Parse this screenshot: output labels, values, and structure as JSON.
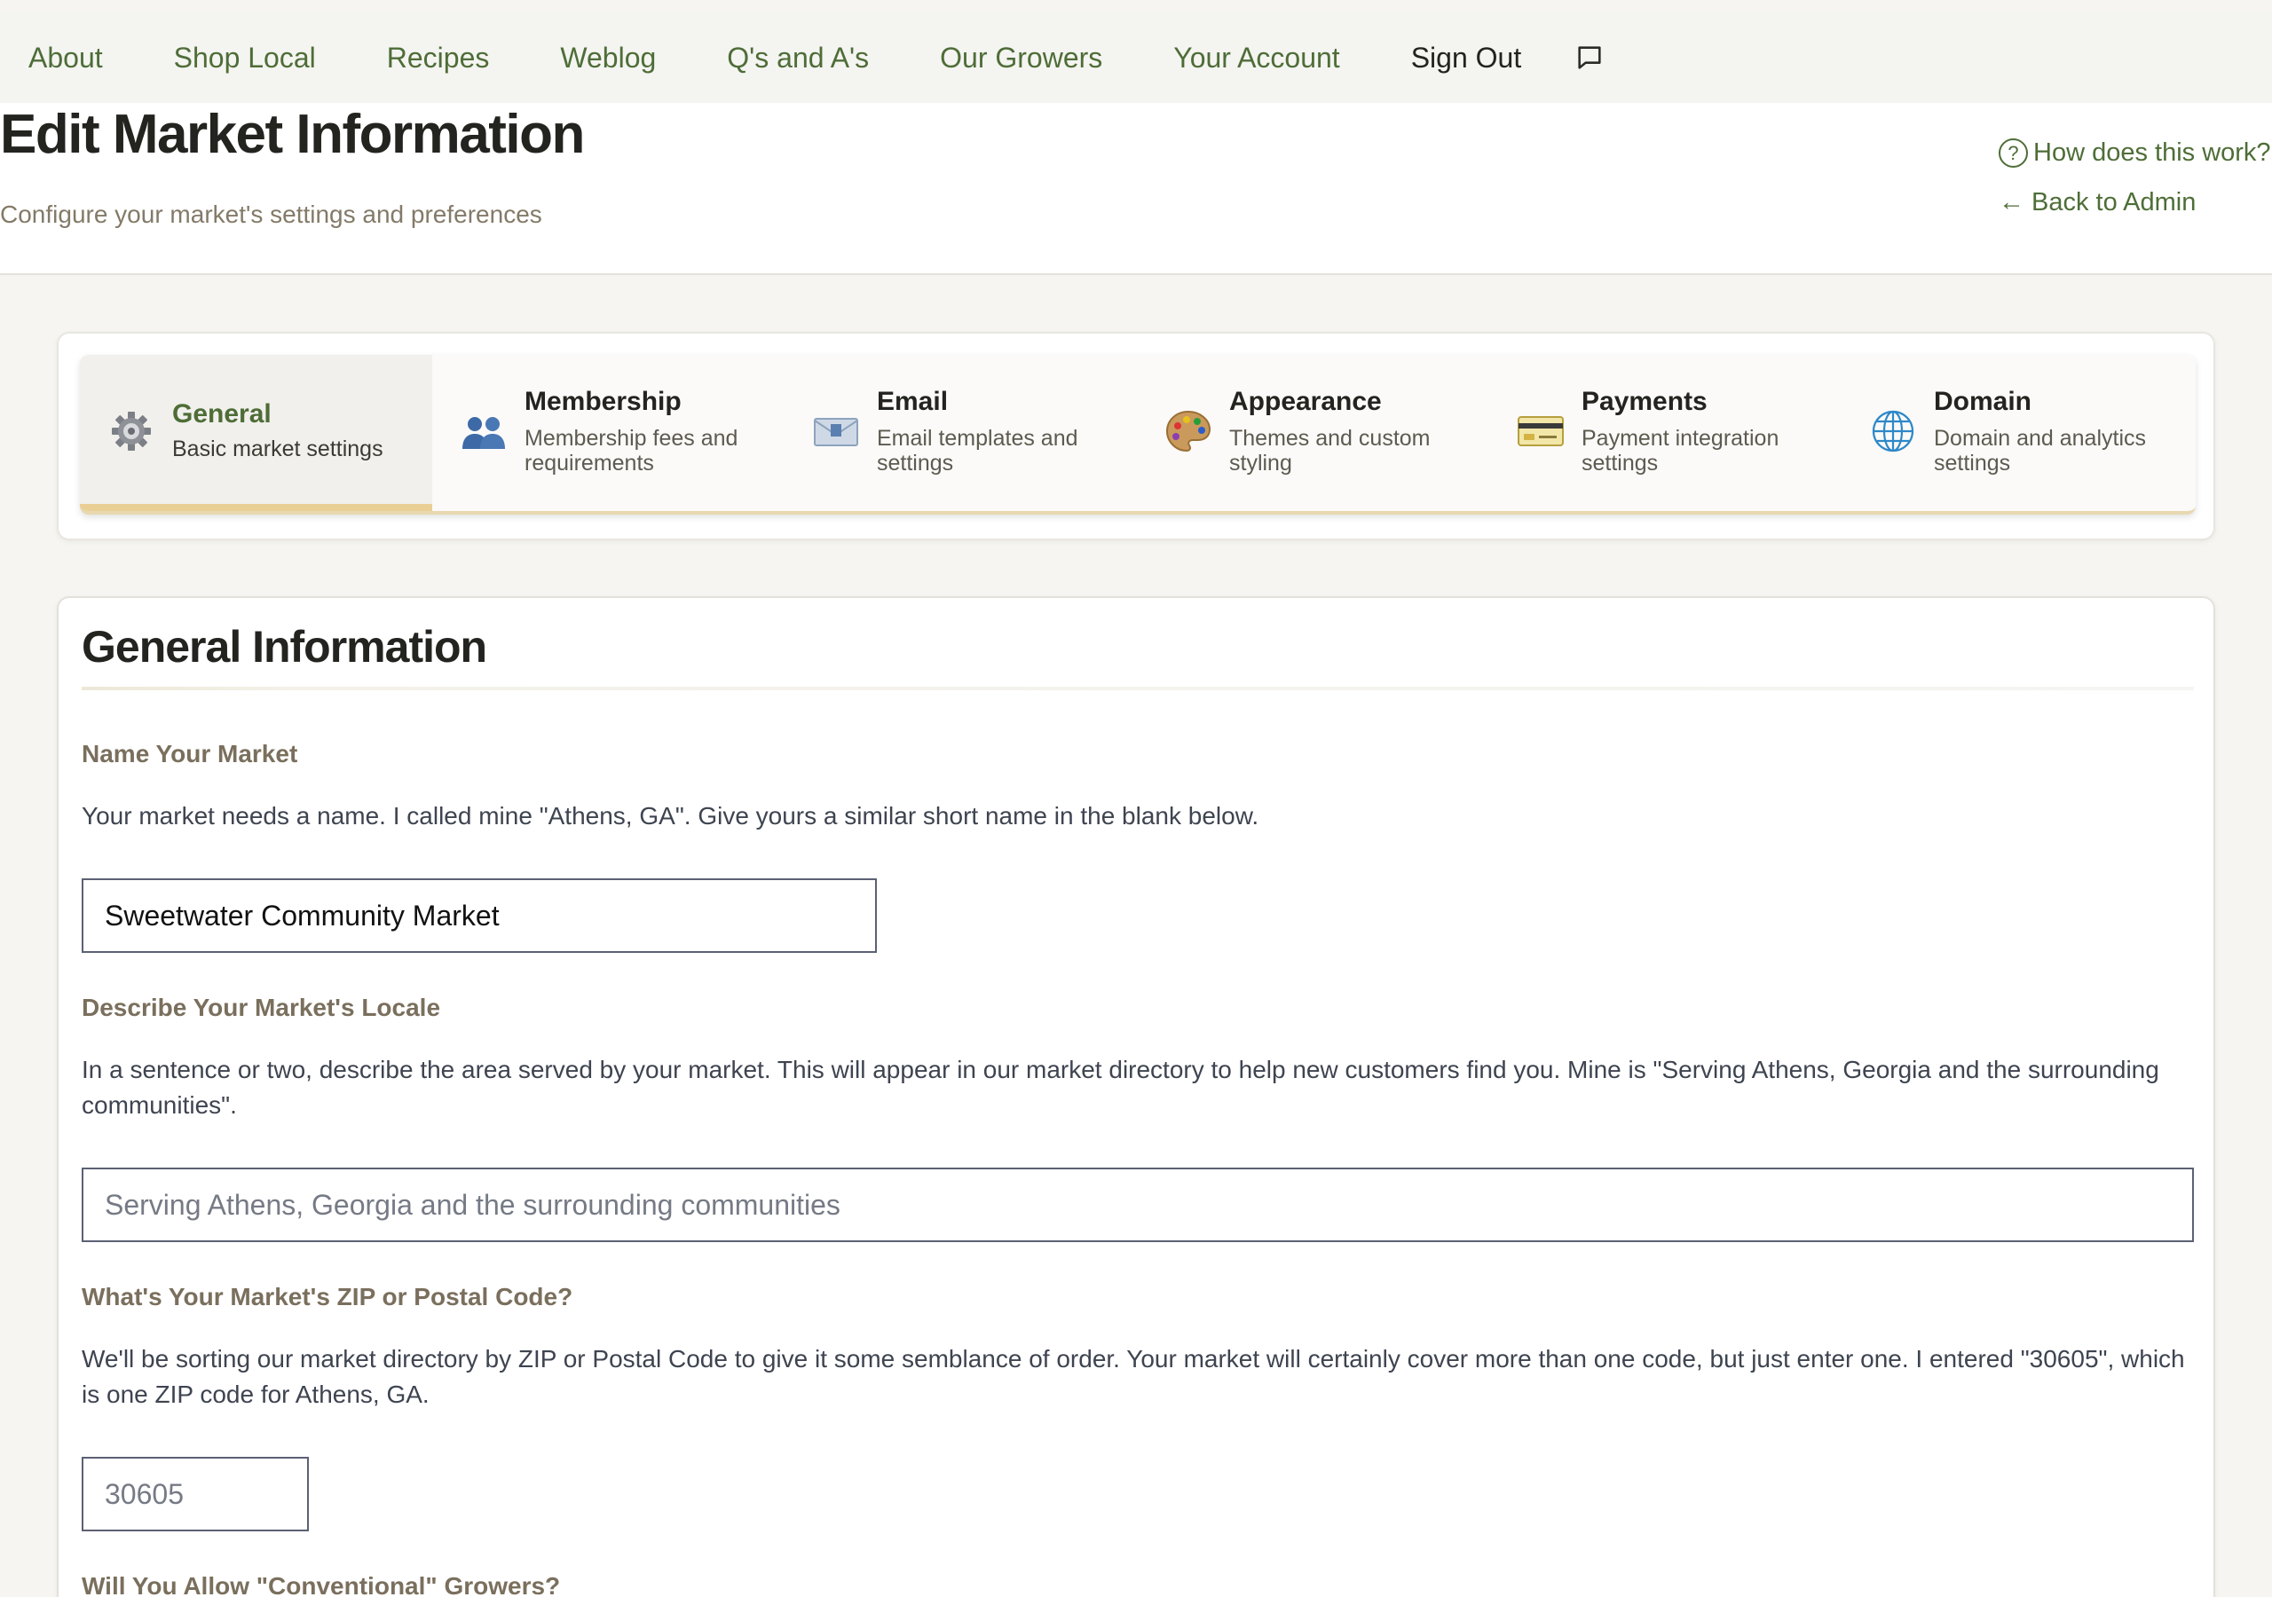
{
  "nav": {
    "items": [
      {
        "label": "About"
      },
      {
        "label": "Shop Local"
      },
      {
        "label": "Recipes"
      },
      {
        "label": "Weblog"
      },
      {
        "label": "Q's and A's"
      },
      {
        "label": "Our Growers"
      },
      {
        "label": "Your Account"
      }
    ],
    "sign_out": "Sign Out",
    "chat_icon": "chat-bubble-icon"
  },
  "header": {
    "title": "Edit Market Information",
    "subtitle": "Configure your market's settings and preferences",
    "help_link": "How does this work?",
    "help_icon": "?",
    "back_arrow": "←",
    "back_link": "Back to Admin"
  },
  "tabs": [
    {
      "title": "General",
      "desc": "Basic market settings",
      "icon": "gear-icon",
      "active": true
    },
    {
      "title": "Membership",
      "desc": "Membership fees and requirements",
      "icon": "people-icon",
      "active": false
    },
    {
      "title": "Email",
      "desc": "Email templates and settings",
      "icon": "envelope-icon",
      "active": false
    },
    {
      "title": "Appearance",
      "desc": "Themes and custom styling",
      "icon": "palette-icon",
      "active": false
    },
    {
      "title": "Payments",
      "desc": "Payment integration settings",
      "icon": "credit-card-icon",
      "active": false
    },
    {
      "title": "Domain",
      "desc": "Domain and analytics settings",
      "icon": "globe-icon",
      "active": false
    }
  ],
  "form": {
    "section_title": "General Information",
    "name": {
      "label": "Name Your Market",
      "help": "Your market needs a name. I called mine \"Athens, GA\". Give yours a similar short name in the blank below.",
      "value": "Sweetwater Community Market"
    },
    "locale": {
      "label": "Describe Your Market's Locale",
      "help": "In a sentence or two, describe the area served by your market. This will appear in our market directory to help new customers find you. Mine is \"Serving Athens, Georgia and the surrounding communities\".",
      "placeholder": "Serving Athens, Georgia and the surrounding communities",
      "value": ""
    },
    "zip": {
      "label": "What's Your Market's ZIP or Postal Code?",
      "help": "We'll be sorting our market directory by ZIP or Postal Code to give it some semblance of order. Your market will certainly cover more than one code, but just enter one. I entered \"30605\", which is one ZIP code for Athens, GA.",
      "placeholder": "30605",
      "value": ""
    },
    "conventional": {
      "label": "Will You Allow \"Conventional\" Growers?"
    }
  },
  "colors": {
    "accent_green": "#4e6d37",
    "active_tab_underline": "#e9cf94",
    "label_brown": "#7a6f5d"
  }
}
